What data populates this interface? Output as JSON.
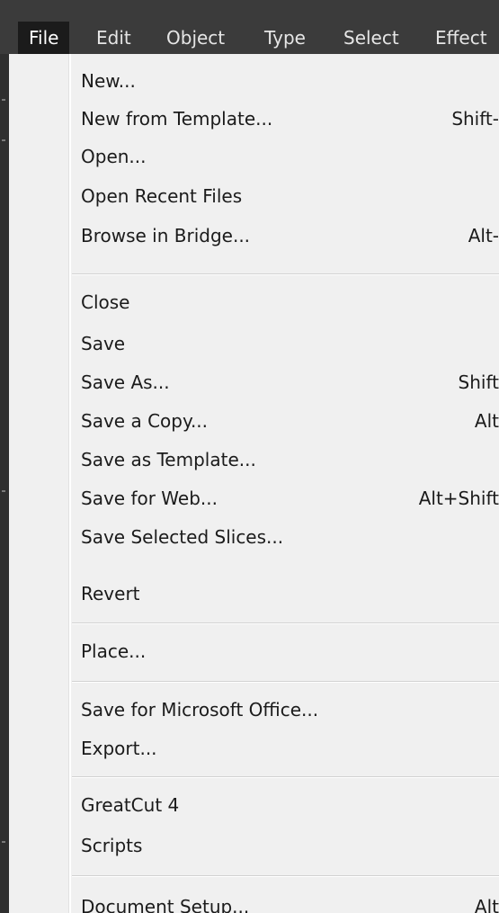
{
  "menubar": {
    "items": [
      {
        "label": "File"
      },
      {
        "label": "Edit"
      },
      {
        "label": "Object"
      },
      {
        "label": "Type"
      },
      {
        "label": "Select"
      },
      {
        "label": "Effect"
      }
    ]
  },
  "file_menu": {
    "items": [
      {
        "label": "New...",
        "shortcut": ""
      },
      {
        "label": "New from Template...",
        "shortcut": "Shift-"
      },
      {
        "label": "Open...",
        "shortcut": ""
      },
      {
        "label": "Open Recent Files",
        "shortcut": ""
      },
      {
        "label": "Browse in Bridge...",
        "shortcut": "Alt-"
      },
      {
        "label": "Close",
        "shortcut": ""
      },
      {
        "label": "Save",
        "shortcut": ""
      },
      {
        "label": "Save As...",
        "shortcut": "Shift"
      },
      {
        "label": "Save a Copy...",
        "shortcut": "Alt"
      },
      {
        "label": "Save as Template...",
        "shortcut": ""
      },
      {
        "label": "Save for Web...",
        "shortcut": "Alt+Shift"
      },
      {
        "label": "Save Selected Slices...",
        "shortcut": ""
      },
      {
        "label": "Revert",
        "shortcut": ""
      },
      {
        "label": "Place...",
        "shortcut": ""
      },
      {
        "label": "Save for Microsoft Office...",
        "shortcut": ""
      },
      {
        "label": "Export...",
        "shortcut": ""
      },
      {
        "label": "GreatCut 4",
        "shortcut": ""
      },
      {
        "label": "Scripts",
        "shortcut": ""
      },
      {
        "label": "Document Setup...",
        "shortcut": "Alt"
      }
    ]
  }
}
